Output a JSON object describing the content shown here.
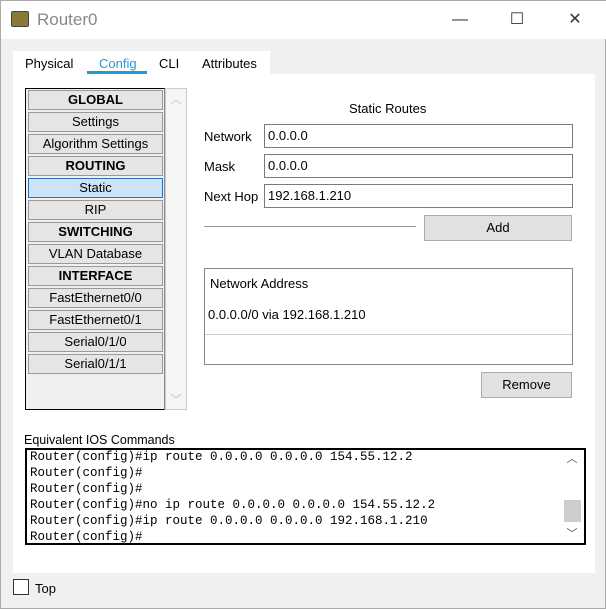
{
  "window": {
    "title": "Router0",
    "minimize": "—",
    "maximize": "☐",
    "close": "✕"
  },
  "tabs": [
    {
      "label": "Physical"
    },
    {
      "label": "Config",
      "active": true
    },
    {
      "label": "CLI"
    },
    {
      "label": "Attributes"
    }
  ],
  "accent": "#1e9bd7",
  "sidebar": {
    "items": [
      {
        "label": "GLOBAL",
        "header": true
      },
      {
        "label": "Settings"
      },
      {
        "label": "Algorithm Settings"
      },
      {
        "label": "ROUTING",
        "header": true
      },
      {
        "label": "Static",
        "selected": true
      },
      {
        "label": "RIP"
      },
      {
        "label": "SWITCHING",
        "header": true
      },
      {
        "label": "VLAN Database"
      },
      {
        "label": "INTERFACE",
        "header": true
      },
      {
        "label": "FastEthernet0/0"
      },
      {
        "label": "FastEthernet0/1"
      },
      {
        "label": "Serial0/1/0"
      },
      {
        "label": "Serial0/1/1"
      }
    ]
  },
  "static_routes": {
    "title": "Static Routes",
    "network_label": "Network",
    "network_value": "0.0.0.0",
    "mask_label": "Mask",
    "mask_value": "0.0.0.0",
    "nexthop_label": "Next Hop",
    "nexthop_value": "192.168.1.210",
    "add_label": "Add",
    "table_header": "Network Address",
    "rows": [
      "0.0.0.0/0 via 192.168.1.210"
    ],
    "remove_label": "Remove"
  },
  "ios": {
    "label": "Equivalent IOS Commands",
    "lines": [
      "Router(config)#ip route 0.0.0.0 0.0.0.0 154.55.12.2",
      "Router(config)#",
      "Router(config)#",
      "Router(config)#no ip route 0.0.0.0 0.0.0.0 154.55.12.2",
      "Router(config)#ip route 0.0.0.0 0.0.0.0 192.168.1.210",
      "Router(config)#"
    ]
  },
  "footer": {
    "top_label": "Top",
    "top_checked": false
  }
}
